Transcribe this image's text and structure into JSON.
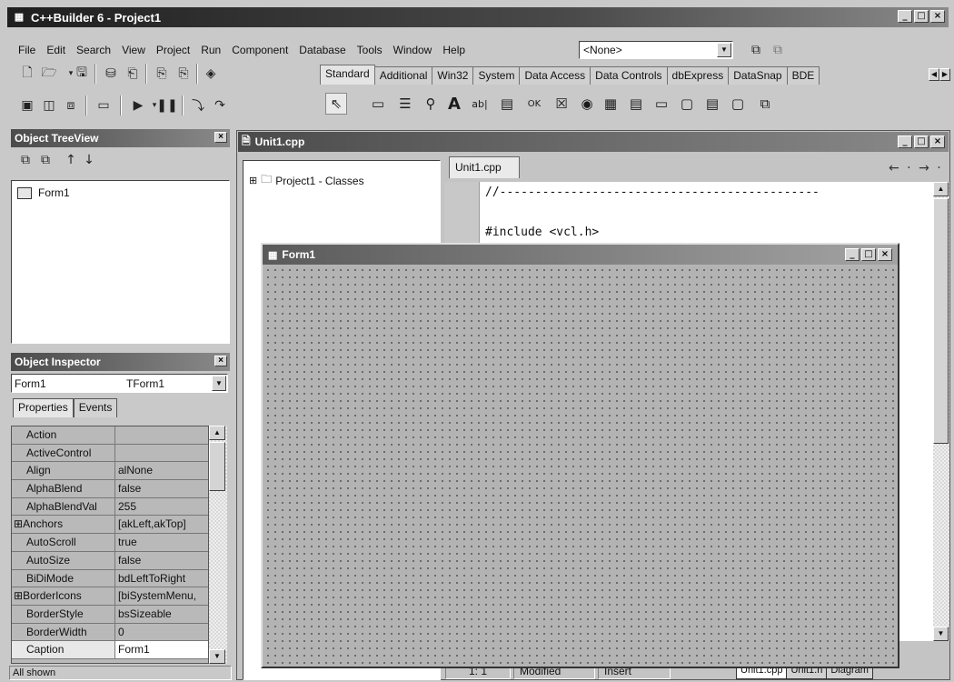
{
  "app": {
    "title": "C++Builder 6 - Project1",
    "window_buttons": [
      "_",
      "□",
      "×"
    ]
  },
  "menu": [
    {
      "label": "File"
    },
    {
      "label": "Edit"
    },
    {
      "label": "Search"
    },
    {
      "label": "View"
    },
    {
      "label": "Project"
    },
    {
      "label": "Run"
    },
    {
      "label": "Component"
    },
    {
      "label": "Database"
    },
    {
      "label": "Tools"
    },
    {
      "label": "Window"
    },
    {
      "label": "Help"
    }
  ],
  "desktop_combo": {
    "value": "<None>"
  },
  "palette_tabs": [
    "Standard",
    "Additional",
    "Win32",
    "System",
    "Data Access",
    "Data Controls",
    "dbExpress",
    "DataSnap",
    "BDE"
  ],
  "object_treeview": {
    "title": "Object TreeView",
    "node": "Form1"
  },
  "object_inspector": {
    "title": "Object Inspector",
    "selected_object": "Form1",
    "selected_class": "TForm1",
    "tabs": [
      "Properties",
      "Events"
    ],
    "properties": [
      {
        "name": "Action",
        "value": ""
      },
      {
        "name": "ActiveControl",
        "value": ""
      },
      {
        "name": "Align",
        "value": "alNone"
      },
      {
        "name": "AlphaBlend",
        "value": "false"
      },
      {
        "name": "AlphaBlendVal",
        "value": "255"
      },
      {
        "name": "Anchors",
        "value": "[akLeft,akTop]",
        "expand": "⊞"
      },
      {
        "name": "AutoScroll",
        "value": "true"
      },
      {
        "name": "AutoSize",
        "value": "false"
      },
      {
        "name": "BiDiMode",
        "value": "bdLeftToRight"
      },
      {
        "name": "BorderIcons",
        "value": "[biSystemMenu,",
        "expand": "⊞"
      },
      {
        "name": "BorderStyle",
        "value": "bsSizeable"
      },
      {
        "name": "BorderWidth",
        "value": "0"
      },
      {
        "name": "Caption",
        "value": "Form1"
      }
    ],
    "status": "All shown"
  },
  "editor": {
    "window_title": "Unit1.cpp",
    "class_tree": "Project1 - Classes",
    "tab": "Unit1.cpp",
    "code_lines": [
      "//---------------------------------------------",
      "",
      "#include <vcl.h>"
    ],
    "status": {
      "position": "1:   1",
      "modified": "Modified",
      "mode": "Insert"
    },
    "bottom_tabs": [
      "Unit1.cpp",
      "Unit1.h",
      "Diagram"
    ]
  },
  "form_designer": {
    "title": "Form1"
  }
}
